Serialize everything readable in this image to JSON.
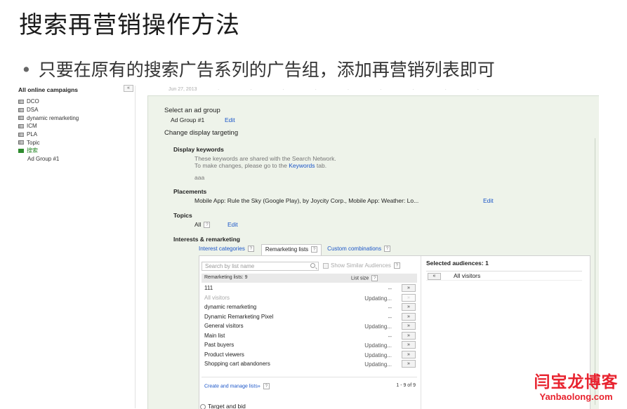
{
  "slide": {
    "title": "搜索再营销操作方法",
    "bullet": "只要在原有的搜索广告系列的广告组，添加再营销列表即可"
  },
  "sidebar": {
    "heading": "All online campaigns",
    "collapse": "«",
    "campaigns": [
      {
        "label": "DCO"
      },
      {
        "label": "DSA"
      },
      {
        "label": "dynamic remarketing"
      },
      {
        "label": "ICM"
      },
      {
        "label": "PLA"
      },
      {
        "label": "Topic"
      },
      {
        "label": "搜索"
      },
      {
        "label": "Ad Group #1"
      }
    ]
  },
  "date_strip": "Jun 27, 2013",
  "panel": {
    "select_ad_group": "Select an ad group",
    "ad_group_name": "Ad Group #1",
    "edit": "Edit",
    "change_targeting": "Change display targeting",
    "display_keywords": {
      "heading": "Display keywords",
      "note1": "These keywords are shared with the Search Network.",
      "note2_prefix": "To make changes, please go to the",
      "note2_link": "Keywords",
      "note2_suffix": "tab.",
      "keyword": "aaa"
    },
    "placements": {
      "heading": "Placements",
      "value": "Mobile App: Rule the Sky (Google Play), by Joycity Corp., Mobile App: Weather: Lo...",
      "edit": "Edit"
    },
    "topics": {
      "heading": "Topics",
      "value": "All",
      "edit": "Edit"
    },
    "interests": {
      "heading": "Interests & remarketing",
      "tabs": [
        {
          "label": "Interest categories"
        },
        {
          "label": "Remarketing lists"
        },
        {
          "label": "Custom combinations"
        }
      ],
      "search_placeholder": "Search by list name",
      "similar_label": "Show Similar Audiences",
      "list_heading": "Remarketing lists: 9",
      "size_heading": "List size",
      "lists": [
        {
          "name": "111",
          "size": "--",
          "add": "»"
        },
        {
          "name": "All visitors",
          "size": "Updating...",
          "add": "»"
        },
        {
          "name": "dynamic remarketing",
          "size": "--",
          "add": "»"
        },
        {
          "name": "Dynamic Remarketing Pixel",
          "size": "--",
          "add": "»"
        },
        {
          "name": "General visitors",
          "size": "Updating...",
          "add": "»"
        },
        {
          "name": "Main list",
          "size": "--",
          "add": "»"
        },
        {
          "name": "Past buyers",
          "size": "Updating...",
          "add": "»"
        },
        {
          "name": "Product viewers",
          "size": "Updating...",
          "add": "»"
        },
        {
          "name": "Shopping cart abandoners",
          "size": "Updating...",
          "add": "»"
        }
      ],
      "manage_link": "Create and manage lists»",
      "pagination": "1 - 9 of 9",
      "selected_heading": "Selected audiences: 1",
      "selected": [
        {
          "name": "All visitors",
          "remove": "«"
        }
      ],
      "help": "?"
    },
    "target_bid": "Target and bid"
  },
  "watermark": {
    "cn": "闫宝龙博客",
    "en": "Yanbaolong.com"
  },
  "colors": {
    "link": "#1a55c8",
    "panel_bg": "#eef3ea",
    "active_campaign": "#2e8b2e",
    "watermark": "#e8222e"
  }
}
